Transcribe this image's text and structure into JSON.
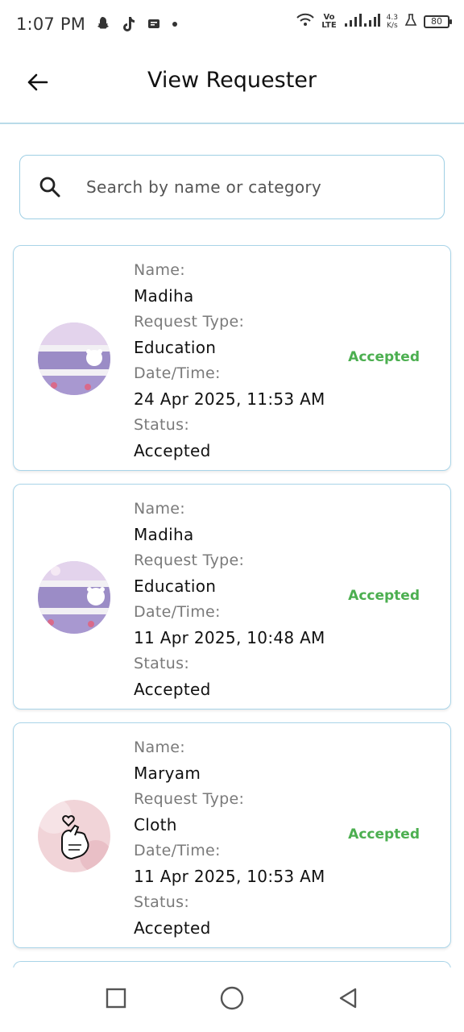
{
  "status_bar": {
    "time": "1:07 PM",
    "volte_line1": "Vo",
    "volte_line2": "LTE",
    "speed_line1": "4.3",
    "speed_line2": "K/s",
    "battery": "80",
    "icons": [
      "snapchat-icon",
      "tiktok-icon",
      "message-icon",
      "dot-icon",
      "wifi-icon",
      "signal-icon",
      "flask-icon",
      "battery-icon"
    ]
  },
  "app_bar": {
    "title": "View Requester",
    "back_icon": "arrow-left-icon"
  },
  "search": {
    "placeholder": "Search by name or category",
    "icon": "search-icon"
  },
  "labels": {
    "name": "Name:",
    "request_type": "Request Type:",
    "date_time": "Date/Time:",
    "status": "Status:"
  },
  "requests": [
    {
      "name": "Madiha",
      "request_type": "Education",
      "date_time": "24 Apr 2025, 11:53 AM",
      "status": "Accepted",
      "badge": "Accepted"
    },
    {
      "name": "Madiha",
      "request_type": "Education",
      "date_time": "11 Apr 2025, 10:48 AM",
      "status": "Accepted",
      "badge": "Accepted"
    },
    {
      "name": "Maryam",
      "request_type": "Cloth",
      "date_time": "11 Apr 2025, 10:53 AM",
      "status": "Accepted",
      "badge": "Accepted"
    }
  ],
  "colors": {
    "accent_border": "#a9d4e8",
    "accepted": "#4caf50"
  },
  "nav_bar": {
    "icons": [
      "recent-apps-icon",
      "home-icon",
      "back-icon"
    ]
  }
}
